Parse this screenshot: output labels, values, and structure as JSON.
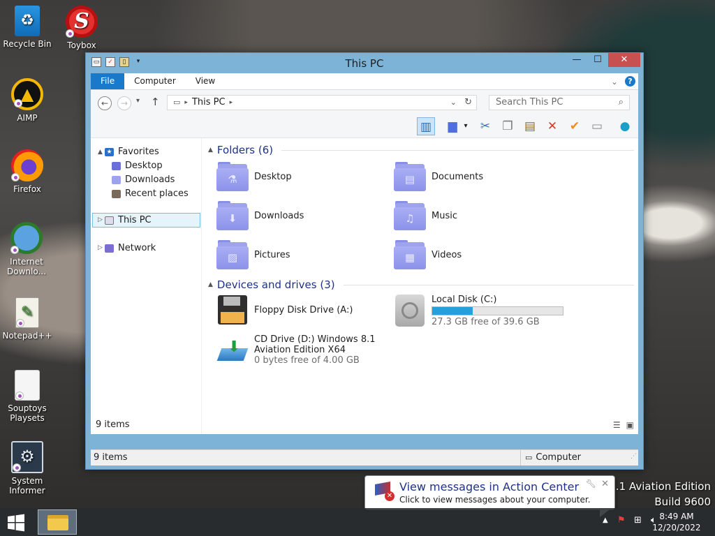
{
  "desktop": {
    "icons": [
      {
        "label": "Recycle Bin",
        "icon": "recycle-bin-icon"
      },
      {
        "label": "Toybox",
        "icon": "toybox-icon"
      },
      {
        "label": "AIMP",
        "icon": "aimp-icon"
      },
      {
        "label": "Firefox",
        "icon": "firefox-icon"
      },
      {
        "label": "Internet Downlo...",
        "icon": "internet-download-manager-icon"
      },
      {
        "label": "Notepad++",
        "icon": "notepad-plus-plus-icon"
      },
      {
        "label": "Souptoys Playsets",
        "icon": "souptoys-icon"
      },
      {
        "label": "System Informer",
        "icon": "system-informer-icon"
      }
    ],
    "watermark_line1": ".1 Aviation Edition",
    "watermark_line2": "Build 9600"
  },
  "window": {
    "title": "This PC",
    "tabs": {
      "file": "File",
      "computer": "Computer",
      "view": "View"
    },
    "help": "?",
    "address": {
      "crumb": "This PC"
    },
    "search_placeholder": "Search This PC",
    "nav": {
      "favorites": "Favorites",
      "desktop": "Desktop",
      "downloads": "Downloads",
      "recent": "Recent places",
      "thispc": "This PC",
      "network": "Network"
    },
    "groups": {
      "folders": "Folders (6)",
      "devices": "Devices and drives (3)"
    },
    "folders": [
      "Desktop",
      "Documents",
      "Downloads",
      "Music",
      "Pictures",
      "Videos"
    ],
    "drives": {
      "floppy": {
        "name": "Floppy Disk Drive (A:)"
      },
      "local": {
        "name": "Local Disk (C:)",
        "free": "27.3 GB free of 39.6 GB",
        "used_fraction": 0.31
      },
      "cd": {
        "name1": "CD Drive (D:) Windows 8.1",
        "name2": "Aviation Edition X64",
        "free": "0 bytes free of 4.00 GB"
      }
    },
    "items_inner": "9 items",
    "status": {
      "items": "9 items",
      "computer": "Computer"
    }
  },
  "balloon": {
    "title": "View messages in Action Center",
    "subtitle": "Click to view messages about your computer."
  },
  "taskbar": {
    "time": "8:49 AM",
    "date": "12/20/2022"
  },
  "colors": {
    "accent": "#1979ca",
    "folder": "#9fa3ee",
    "titlebar": "#7eb3d8",
    "close": "#c75050",
    "progress": "#26a0da"
  }
}
